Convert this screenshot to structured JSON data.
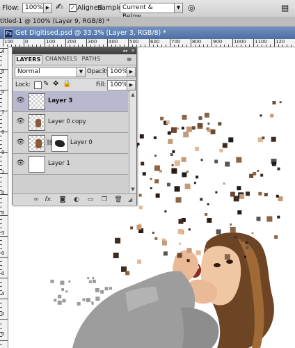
{
  "options_bar": {
    "flow_label": "Flow:",
    "flow_value": "100%",
    "aligned_label": "Aligned",
    "aligned_checked": true,
    "sample_label": "Sample:",
    "sample_value": "Current & Below"
  },
  "tabs": [
    {
      "label": "titled-1 @ 100% (Layer 9, RGB/8) *",
      "close": "×"
    }
  ],
  "document": {
    "title": "Get Digitised.psd @ 33.3% (Layer 3, RGB/8) *",
    "icon_label": "Ps"
  },
  "ruler_h_labels": [
    "100",
    "0",
    "100",
    "200",
    "300",
    "400",
    "500",
    "600",
    "700",
    "800",
    "900",
    "1000",
    "1100",
    "120"
  ],
  "ruler_v_labels": [
    "4",
    "0",
    "0",
    "1",
    "0",
    "0",
    "2",
    "0",
    "0",
    "3",
    "0",
    "0",
    "4",
    "0",
    "0"
  ],
  "layers_panel": {
    "tabs": [
      "LAYERS",
      "CHANNELS",
      "PATHS"
    ],
    "active_tab": "LAYERS",
    "blend_mode": "Normal",
    "opacity_label": "Opacity:",
    "opacity_value": "100%",
    "lock_label": "Lock:",
    "fill_label": "Fill:",
    "fill_value": "100%",
    "layers": [
      {
        "name": "Layer 3",
        "selected": true,
        "visible": true
      },
      {
        "name": "Layer 0 copy",
        "selected": false,
        "visible": true
      },
      {
        "name": "Layer 0",
        "selected": false,
        "visible": true,
        "has_mask": true
      },
      {
        "name": "Layer 1",
        "selected": false,
        "visible": true
      }
    ],
    "bottom_icons": [
      "link-icon",
      "fx-icon",
      "mask-icon",
      "adjustment-icon",
      "folder-icon",
      "new-layer-icon",
      "trash-icon"
    ],
    "bottom_fx_label": "fx."
  },
  "colors": {
    "title_bar": "#5a7bb0",
    "selected_layer": "#b8b8cf",
    "panel_bg": "#d6d6d6"
  }
}
